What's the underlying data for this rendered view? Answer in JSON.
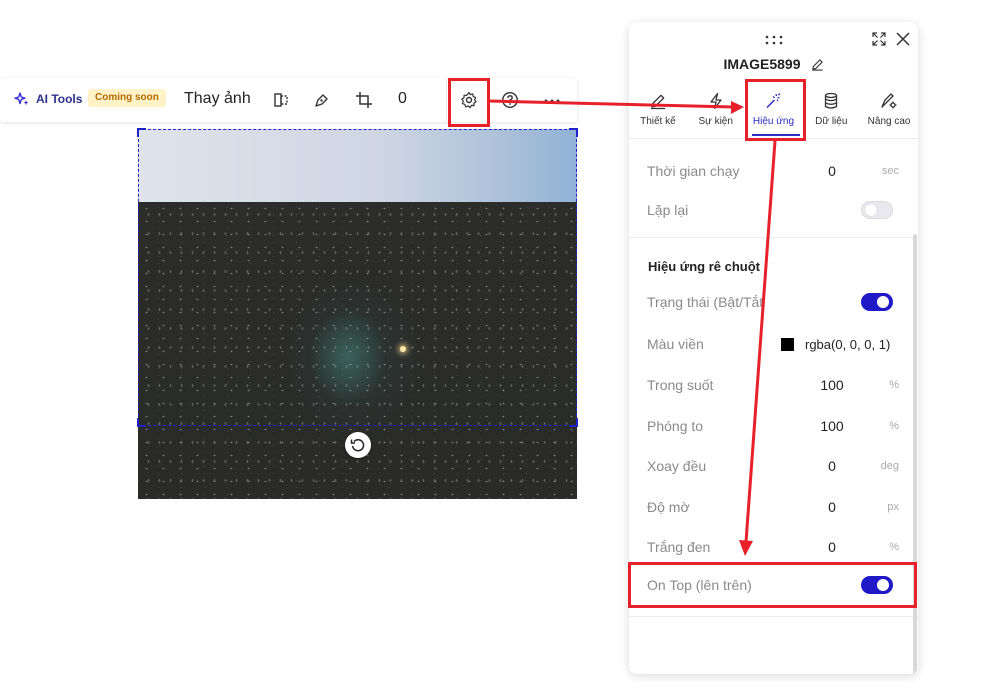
{
  "toolbar": {
    "ai_label": "AI Tools",
    "ai_badge": "Coming soon",
    "replace_label": "Thay ảnh",
    "count": "0",
    "icons": [
      "sparkle-icon",
      "flip-icon",
      "pen-tool-icon",
      "crop-icon",
      "gear-icon",
      "help-icon",
      "more-icon"
    ]
  },
  "panel": {
    "title": "IMAGE5899",
    "tabs": [
      {
        "label": "Thiết kế",
        "icon": "edit-icon"
      },
      {
        "label": "Sự kiện",
        "icon": "lightning-icon"
      },
      {
        "label": "Hiệu ứng",
        "icon": "magic-wand-icon",
        "active": true
      },
      {
        "label": "Dữ liệu",
        "icon": "database-icon"
      },
      {
        "label": "Nâng cao",
        "icon": "advanced-settings-icon"
      }
    ],
    "run_time": {
      "label": "Thời gian chạy",
      "value": "0",
      "unit": "sec"
    },
    "repeat": {
      "label": "Lặp lại",
      "on": false
    },
    "hover_section_title": "Hiệu ứng rê chuột",
    "status": {
      "label": "Trạng thái (Bật/Tắt",
      "on": true
    },
    "border_color": {
      "label": "Màu viền",
      "value": "rgba(0, 0, 0, 1)",
      "swatch": "#000000"
    },
    "opacity": {
      "label": "Trong suốt",
      "value": "100",
      "unit": "%"
    },
    "zoom": {
      "label": "Phóng to",
      "value": "100",
      "unit": "%"
    },
    "rotate": {
      "label": "Xoay đều",
      "value": "0",
      "unit": "deg"
    },
    "blur": {
      "label": "Độ mờ",
      "value": "0",
      "unit": "px"
    },
    "grayscale": {
      "label": "Trắng đen",
      "value": "0",
      "unit": "%"
    },
    "on_top": {
      "label": "On Top (lên trên)",
      "on": true
    }
  },
  "colors": {
    "accent": "#2019c8",
    "highlight": "#e8202a"
  }
}
